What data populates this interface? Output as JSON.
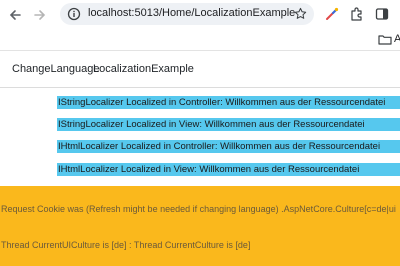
{
  "browser": {
    "url": "localhost:5013/Home/LocalizationExample",
    "bookmark_label": "Al"
  },
  "navbar": {
    "items": [
      "ChangeLanguage",
      "LocalizationExample"
    ]
  },
  "localized_lines": [
    "IStringLocalizer Localized in Controller: Willkommen aus der Ressourcendatei",
    "IStringLocalizer Localized in View: Willkommen aus der Ressourcendatei",
    "IHtmlLocalizer Localized in Controller: Willkommen aus der Ressourcendatei",
    "IHtmlLocalizer Localized in View: Willkommen aus der Ressourcendatei"
  ],
  "info": {
    "cookie_text": "Request Cookie was (Refresh might be needed if changing language) .AspNetCore.Culture[c=de|ui",
    "culture_text": "Thread CurrentUICulture is [de] : Thread CurrentCulture is [de]"
  },
  "colors": {
    "highlight": "#56c8ee",
    "info_background": "#fab81c"
  }
}
